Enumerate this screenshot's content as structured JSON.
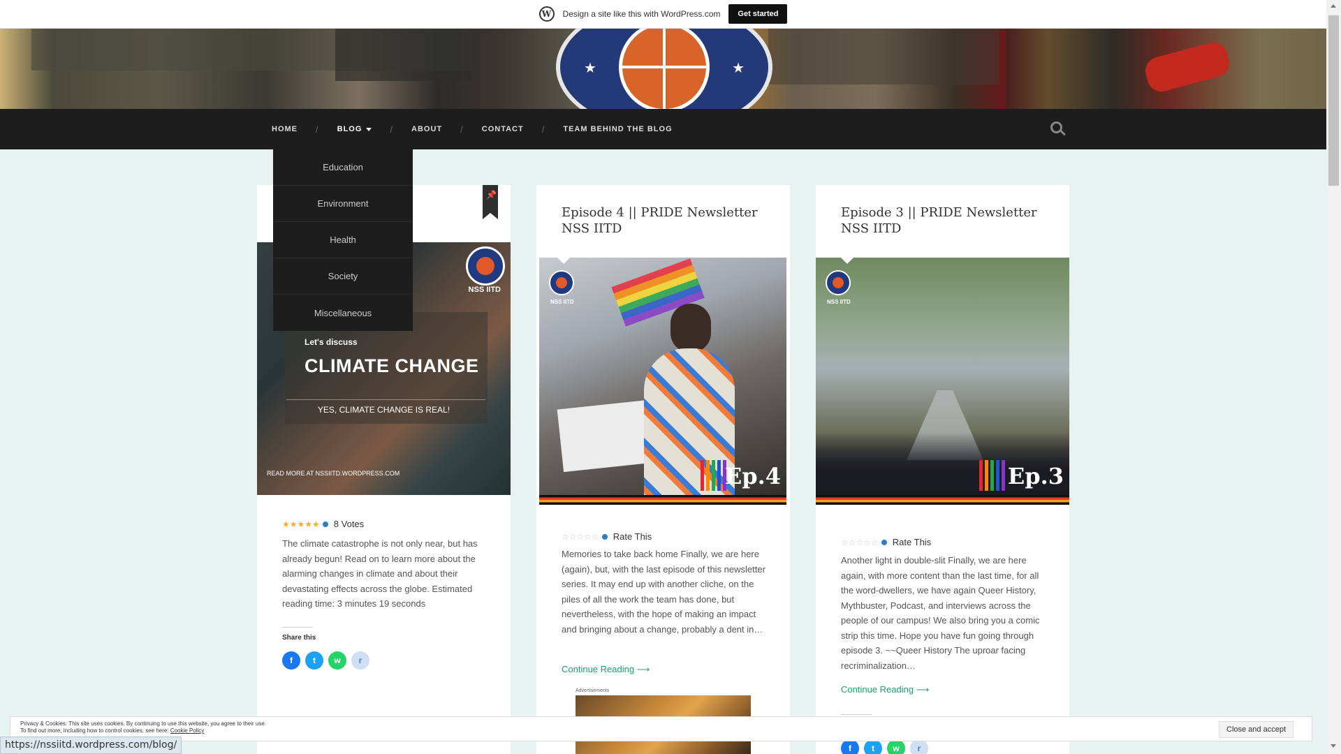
{
  "wp_banner": {
    "text": "Design a site like this with WordPress.com",
    "button": "Get started"
  },
  "nav": {
    "items": [
      "HOME",
      "BLOG",
      "ABOUT",
      "CONTACT",
      "TEAM BEHIND THE BLOG"
    ],
    "separator": "/",
    "active": "BLOG"
  },
  "dropdown": {
    "items": [
      "Education",
      "Environment",
      "Health",
      "Society",
      "Miscellaneous"
    ]
  },
  "posts": [
    {
      "image": {
        "logo_label": "NSS IITD",
        "small": "Let's discuss",
        "title": "CLIMATE CHANGE",
        "tagline": "YES, CLIMATE CHANGE IS REAL!",
        "read_more": "READ MORE AT NSSIITD.WORDPRESS.COM"
      },
      "rating_stars": "★★★★★",
      "rating_label": "8 Votes",
      "excerpt": "The climate catastrophe is not only near, but has already begun! Read on to learn more about the alarming changes in climate and about their devastating effects across the globe. Estimated reading time: 3 minutes 19 seconds",
      "share_title": "Share this"
    },
    {
      "title": "Episode 4 || PRIDE Newsletter NSS IITD",
      "image_logo_label": "NSS IITD",
      "image_label": "Ep.4",
      "rating_stars": "☆☆☆☆☆",
      "rating_label": "Rate This",
      "excerpt": "Memories to take back home Finally, we are here (again), but, with the last episode of this newsletter series. It may end up with another cliche, on the piles of all the work the team has done, but nevertheless, with the hope of making an impact and bringing about a change, probably a dent in…",
      "read_more": "Continue Reading ⟶",
      "ad_label": "Advertisements"
    },
    {
      "title": "Episode 3 || PRIDE Newsletter NSS IITD",
      "image_logo_label": "NSS IITD",
      "image_label": "Ep.3",
      "rating_stars": "☆☆☆☆☆",
      "rating_label": "Rate This",
      "excerpt": "Another light in double-slit Finally, we are here again, with more content than the last time, for all the word-dwellers, we have again Queer History, Mythbuster, Podcast, and interviews across the people of our campus! We also bring you a comic strip this time. Hope you have fun going through episode 3.  ~~Queer History The uproar facing recriminalization…",
      "read_more": "Continue Reading ⟶"
    }
  ],
  "share_buttons": [
    "f",
    "t",
    "w",
    "r"
  ],
  "cookie": {
    "line1": "Privacy & Cookies: This site uses cookies. By continuing to use this website, you agree to their use.",
    "line2": "To find out more, including how to control cookies, see here:",
    "link": "Cookie Policy",
    "accept": "Close and accept"
  },
  "status_url": "https://nssiitd.wordpress.com/blog/",
  "colors": {
    "nav_bg": "#1d1d1d",
    "page_bg": "#e8f2f0",
    "accent_link": "#1aa26f",
    "rating_gold": "#f2b01e"
  },
  "icons": [
    "wordpress-logo-icon",
    "search-icon",
    "bookmark-pin-icon",
    "facebook-icon",
    "twitter-icon",
    "whatsapp-icon",
    "reddit-icon",
    "info-icon",
    "caret-down-icon"
  ]
}
